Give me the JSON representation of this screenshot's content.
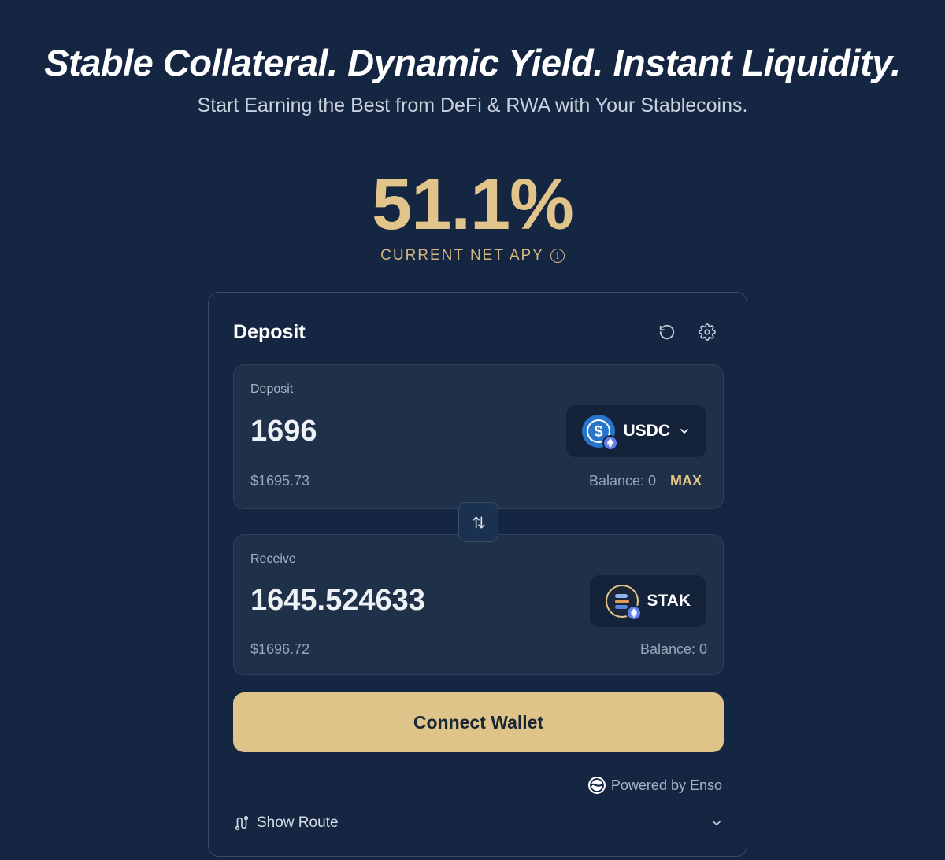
{
  "hero": {
    "title": "Stable Collateral. Dynamic Yield. Instant Liquidity.",
    "subtitle": "Start Earning the Best from DeFi & RWA with Your Stablecoins."
  },
  "apy": {
    "value": "51.1%",
    "label": "CURRENT NET APY",
    "info_icon": "info-icon"
  },
  "card": {
    "title": "Deposit",
    "refresh_icon": "refresh-icon",
    "settings_icon": "gear-icon",
    "deposit": {
      "label": "Deposit",
      "amount": "1696",
      "usd": "$1695.73",
      "token": "USDC",
      "balance": "Balance: 0",
      "max": "MAX"
    },
    "receive": {
      "label": "Receive",
      "amount": "1645.524633",
      "usd": "$1696.72",
      "token": "STAK",
      "balance": "Balance: 0"
    },
    "connect": "Connect Wallet",
    "powered": "Powered by Enso",
    "route": "Show Route"
  },
  "colors": {
    "background": "#142642",
    "accent": "#e0c48a",
    "panel": "#1f3049",
    "usdc": "#2775ca",
    "eth": "#627eea"
  }
}
